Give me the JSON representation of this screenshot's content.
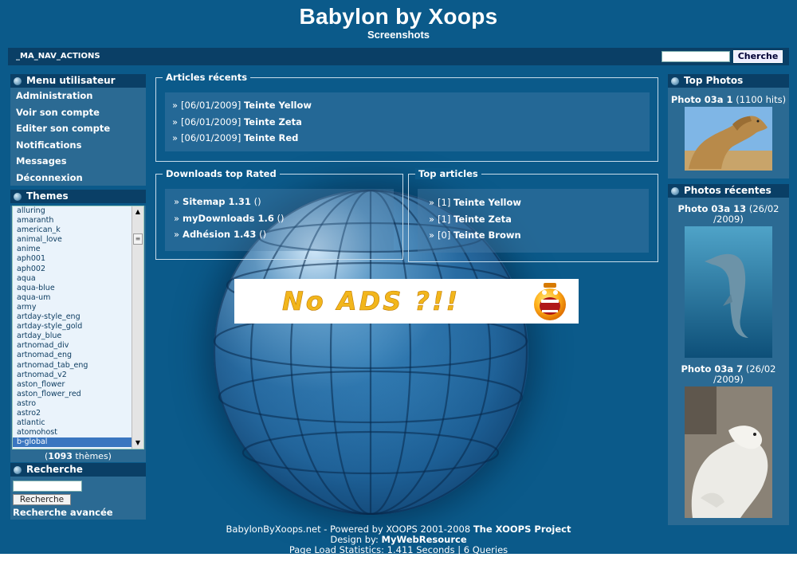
{
  "header": {
    "title": "Babylon by Xoops",
    "slogan": "Screenshots"
  },
  "navbar": {
    "actions_label": "_MA_NAV_ACTIONS",
    "search_value": "",
    "search_button": "Cherche"
  },
  "user_menu": {
    "title": "Menu utilisateur",
    "items": [
      "Administration",
      "Voir son compte",
      "Editer son compte",
      "Notifications",
      "Messages",
      "Déconnexion"
    ]
  },
  "themes": {
    "title": "Themes",
    "items": [
      "alluring",
      "amaranth",
      "american_k",
      "animal_love",
      "anime",
      "aph001",
      "aph002",
      "aqua",
      "aqua-blue",
      "aqua-um",
      "army",
      "artday-style_eng",
      "artday-style_gold",
      "artday_blue",
      "artnomad_div",
      "artnomad_eng",
      "artnomad_tab_eng",
      "artnomad_v2",
      "aston_flower",
      "aston_flower_red",
      "astro",
      "astro2",
      "atlantic",
      "atomohost",
      "b-global"
    ],
    "selected": "b-global",
    "count_open": "(",
    "count_value": "1093",
    "count_suffix": " thèmes)"
  },
  "search": {
    "title": "Recherche",
    "input_value": "",
    "button": "Recherche",
    "advanced_label": "Recherche avancée"
  },
  "recent_articles": {
    "title": "Articles récents",
    "items": [
      {
        "date": "[06/01/2009]",
        "name": "Teinte Yellow"
      },
      {
        "date": "[06/01/2009]",
        "name": "Teinte Zeta"
      },
      {
        "date": "[06/01/2009]",
        "name": "Teinte Red"
      }
    ]
  },
  "downloads_top": {
    "title": "Downloads top Rated",
    "items": [
      {
        "name": "Sitemap 1.31",
        "extra": "()"
      },
      {
        "name": "myDownloads 1.6",
        "extra": "()"
      },
      {
        "name": "Adhésion 1.43",
        "extra": "()"
      }
    ]
  },
  "top_articles": {
    "title": "Top articles",
    "items": [
      {
        "count": "[1]",
        "name": "Teinte Yellow"
      },
      {
        "count": "[1]",
        "name": "Teinte Zeta"
      },
      {
        "count": "[0]",
        "name": "Teinte Brown"
      }
    ]
  },
  "ad": {
    "text": "No ADS ?!!"
  },
  "top_photos": {
    "title": "Top Photos",
    "items": [
      {
        "name": "Photo 03a 1",
        "meta": " (1100 hits)",
        "icon": "camel-photo"
      }
    ]
  },
  "recent_photos": {
    "title": "Photos récentes",
    "items": [
      {
        "name": "Photo 03a 13",
        "meta_line1": " (26/02",
        "meta_line2": "/2009)",
        "icon": "dolphin-photo"
      },
      {
        "name": "Photo 03a 7",
        "meta_line1": " (26/02",
        "meta_line2": "/2009)",
        "icon": "polar-bear-photo"
      }
    ]
  },
  "footer": {
    "line1_prefix": "BabylonByXoops.net - Powered by XOOPS 2001-2008 ",
    "line1_bold": "The XOOPS Project",
    "line2_prefix": "Design by: ",
    "line2_bold": "MyWebResource",
    "line3": "Page Load Statistics: 1.411 Seconds | 6 Queries"
  },
  "colors": {
    "background": "#0b5a8a",
    "block_title": "#0a3f66",
    "selected_theme": "#3a76c0",
    "ad_text": "#f2b61c"
  }
}
